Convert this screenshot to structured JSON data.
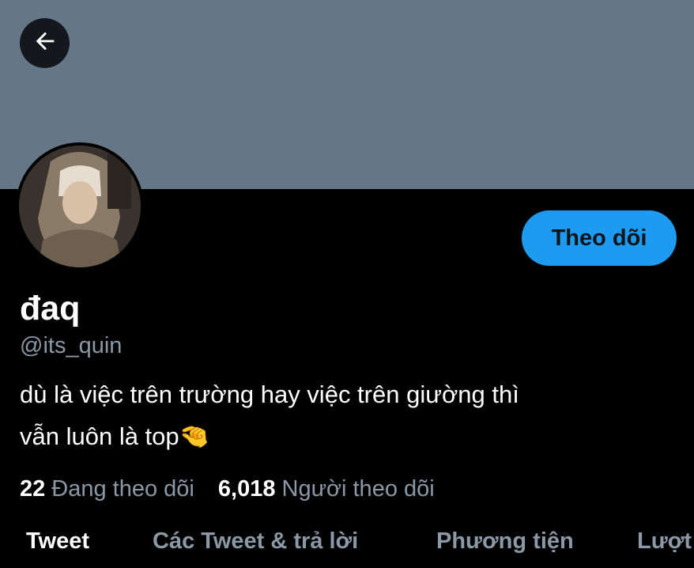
{
  "header": {
    "back_icon": "arrow-left-icon",
    "banner_color": "#657786"
  },
  "profile": {
    "avatar": "profile-photo",
    "display_name": "đaq",
    "handle": "@its_quin",
    "bio_line1": "dù là việc trên trường hay việc trên giường thì",
    "bio_line2": "vẫn luôn là top🤏"
  },
  "actions": {
    "follow_label": "Theo dõi",
    "follow_color": "#1d9bf0"
  },
  "stats": {
    "following_count": "22",
    "following_label": "Đang theo dõi",
    "followers_count": "6,018",
    "followers_label": "Người theo dõi"
  },
  "tabs": [
    {
      "label": "Tweet",
      "active": true
    },
    {
      "label": "Các Tweet & trả lời",
      "active": false
    },
    {
      "label": "Phương tiện",
      "active": false
    },
    {
      "label": "Lượt",
      "active": false
    }
  ]
}
